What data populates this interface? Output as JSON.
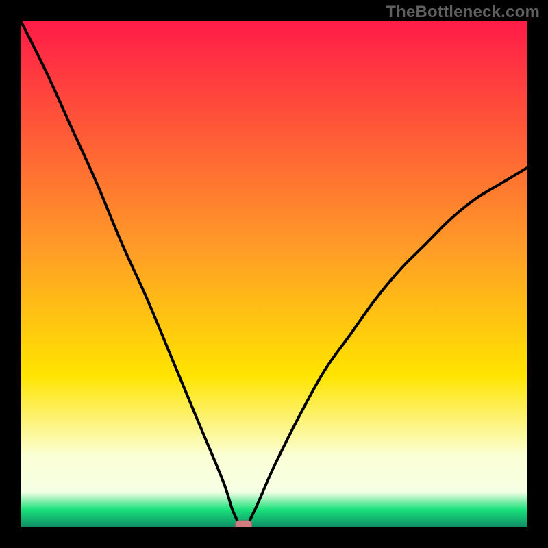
{
  "watermark": "TheBottleneck.com",
  "colors": {
    "top": "#ff1b47",
    "mid": "#ffe400",
    "pale": "#fbffd6",
    "green": "#18e07a",
    "dark_green": "#0f8c65",
    "curve": "#000000",
    "marker": "#cf7b80"
  },
  "chart_data": {
    "type": "line",
    "title": "",
    "xlabel": "",
    "ylabel": "",
    "xlim": [
      0,
      100
    ],
    "ylim": [
      0,
      100
    ],
    "grid": false,
    "series": [
      {
        "name": "bottleneck-curve",
        "x": [
          0,
          5,
          10,
          15,
          20,
          25,
          30,
          35,
          40,
          42,
          44,
          46,
          50,
          55,
          60,
          65,
          70,
          75,
          80,
          85,
          90,
          95,
          100
        ],
        "y": [
          100,
          90,
          79,
          68,
          56,
          45,
          33,
          21,
          9,
          3,
          0,
          3,
          12,
          22,
          31,
          38,
          45,
          51,
          56,
          61,
          65,
          68,
          71
        ]
      }
    ],
    "marker": {
      "x": 44,
      "y": 0
    },
    "background_gradient": {
      "stops": [
        {
          "pos": 0.0,
          "color": "#ff1b47"
        },
        {
          "pos": 0.45,
          "color": "#ff9c27"
        },
        {
          "pos": 0.7,
          "color": "#ffe400"
        },
        {
          "pos": 0.86,
          "color": "#fbffd6"
        },
        {
          "pos": 0.93,
          "color": "#f5ffe4"
        },
        {
          "pos": 0.965,
          "color": "#18e07a"
        },
        {
          "pos": 1.0,
          "color": "#0f8c65"
        }
      ]
    }
  }
}
